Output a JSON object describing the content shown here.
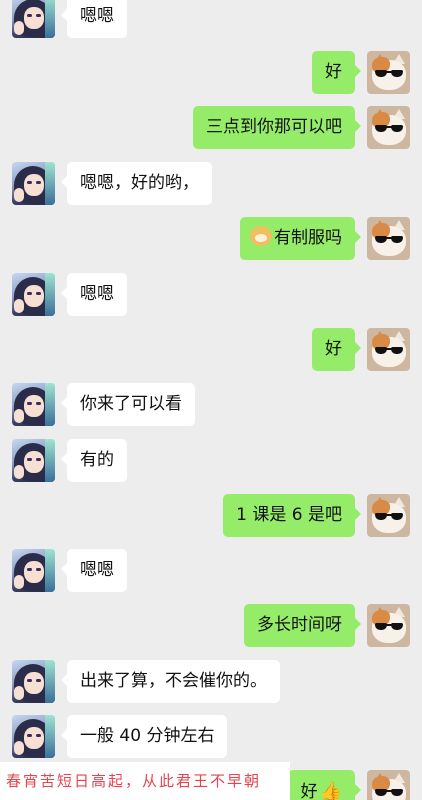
{
  "messages": [
    {
      "side": "left",
      "text": "嗯嗯"
    },
    {
      "side": "right",
      "text": "好"
    },
    {
      "side": "right",
      "text": "三点到你那可以吧"
    },
    {
      "side": "left",
      "text": "嗯嗯，好的哟，"
    },
    {
      "side": "right",
      "text": "有制服吗",
      "emoji": "doge-emoji"
    },
    {
      "side": "left",
      "text": "嗯嗯"
    },
    {
      "side": "right",
      "text": "好"
    },
    {
      "side": "left",
      "text": "你来了可以看"
    },
    {
      "side": "left",
      "text": "有的"
    },
    {
      "side": "right",
      "text": "1 课是 6 是吧"
    },
    {
      "side": "left",
      "text": "嗯嗯"
    },
    {
      "side": "right",
      "text": "多长时间呀"
    },
    {
      "side": "left",
      "text": "出来了算，不会催你的。"
    },
    {
      "side": "left",
      "text": "一般 40 分钟左右"
    },
    {
      "side": "right",
      "text": "好",
      "emoji": "thumbs-up-emoji"
    }
  ],
  "caption": "春宵苦短日高起，从此君王不早朝",
  "colors": {
    "background": "#ededed",
    "outgoing_bubble": "#95ec69",
    "incoming_bubble": "#ffffff",
    "caption_text": "#e8434d"
  }
}
